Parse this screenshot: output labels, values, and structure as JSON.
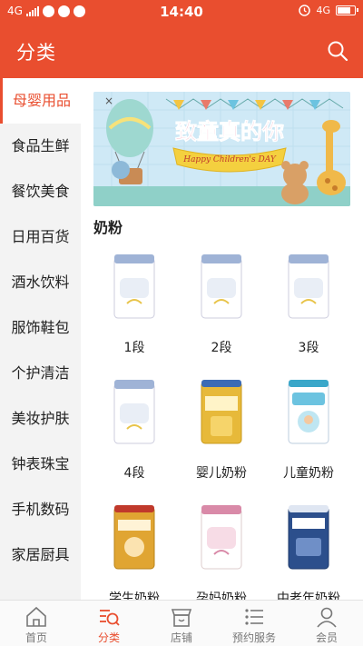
{
  "status_bar": {
    "network": "4G",
    "time": "14:40",
    "network_right": "4G"
  },
  "header": {
    "title": "分类"
  },
  "sidebar": {
    "items": [
      {
        "label": "母婴用品"
      },
      {
        "label": "食品生鲜"
      },
      {
        "label": "餐饮美食"
      },
      {
        "label": "日用百货"
      },
      {
        "label": "酒水饮料"
      },
      {
        "label": "服饰鞋包"
      },
      {
        "label": "个护清洁"
      },
      {
        "label": "美妆护肤"
      },
      {
        "label": "钟表珠宝"
      },
      {
        "label": "手机数码"
      },
      {
        "label": "家居厨具"
      }
    ],
    "active_index": 0
  },
  "banner": {
    "title": "致童真的你",
    "ribbon": "Happy Children's DAY"
  },
  "section": {
    "title": "奶粉"
  },
  "products": [
    {
      "label": "1段",
      "color": "#9fb3d6"
    },
    {
      "label": "2段",
      "color": "#9fb3d6"
    },
    {
      "label": "3段",
      "color": "#9fb3d6"
    },
    {
      "label": "4段",
      "color": "#9fb3d6"
    },
    {
      "label": "婴儿奶粉",
      "color": "#e7b93a"
    },
    {
      "label": "儿童奶粉",
      "color": "#3aa7c9"
    },
    {
      "label": "学生奶粉",
      "color": "#e0a532"
    },
    {
      "label": "孕妈奶粉",
      "color": "#d98aa8"
    },
    {
      "label": "中老年奶粉",
      "color": "#2c4f8c"
    }
  ],
  "tabbar": {
    "items": [
      {
        "label": "首页",
        "icon": "home-icon"
      },
      {
        "label": "分类",
        "icon": "category-icon"
      },
      {
        "label": "店铺",
        "icon": "shop-icon"
      },
      {
        "label": "预约服务",
        "icon": "list-icon"
      },
      {
        "label": "会员",
        "icon": "user-icon"
      }
    ],
    "active_index": 1
  },
  "colors": {
    "brand": "#e94e2f",
    "sidebar_bg": "#f3f3f3",
    "tab_inactive": "#777777"
  }
}
